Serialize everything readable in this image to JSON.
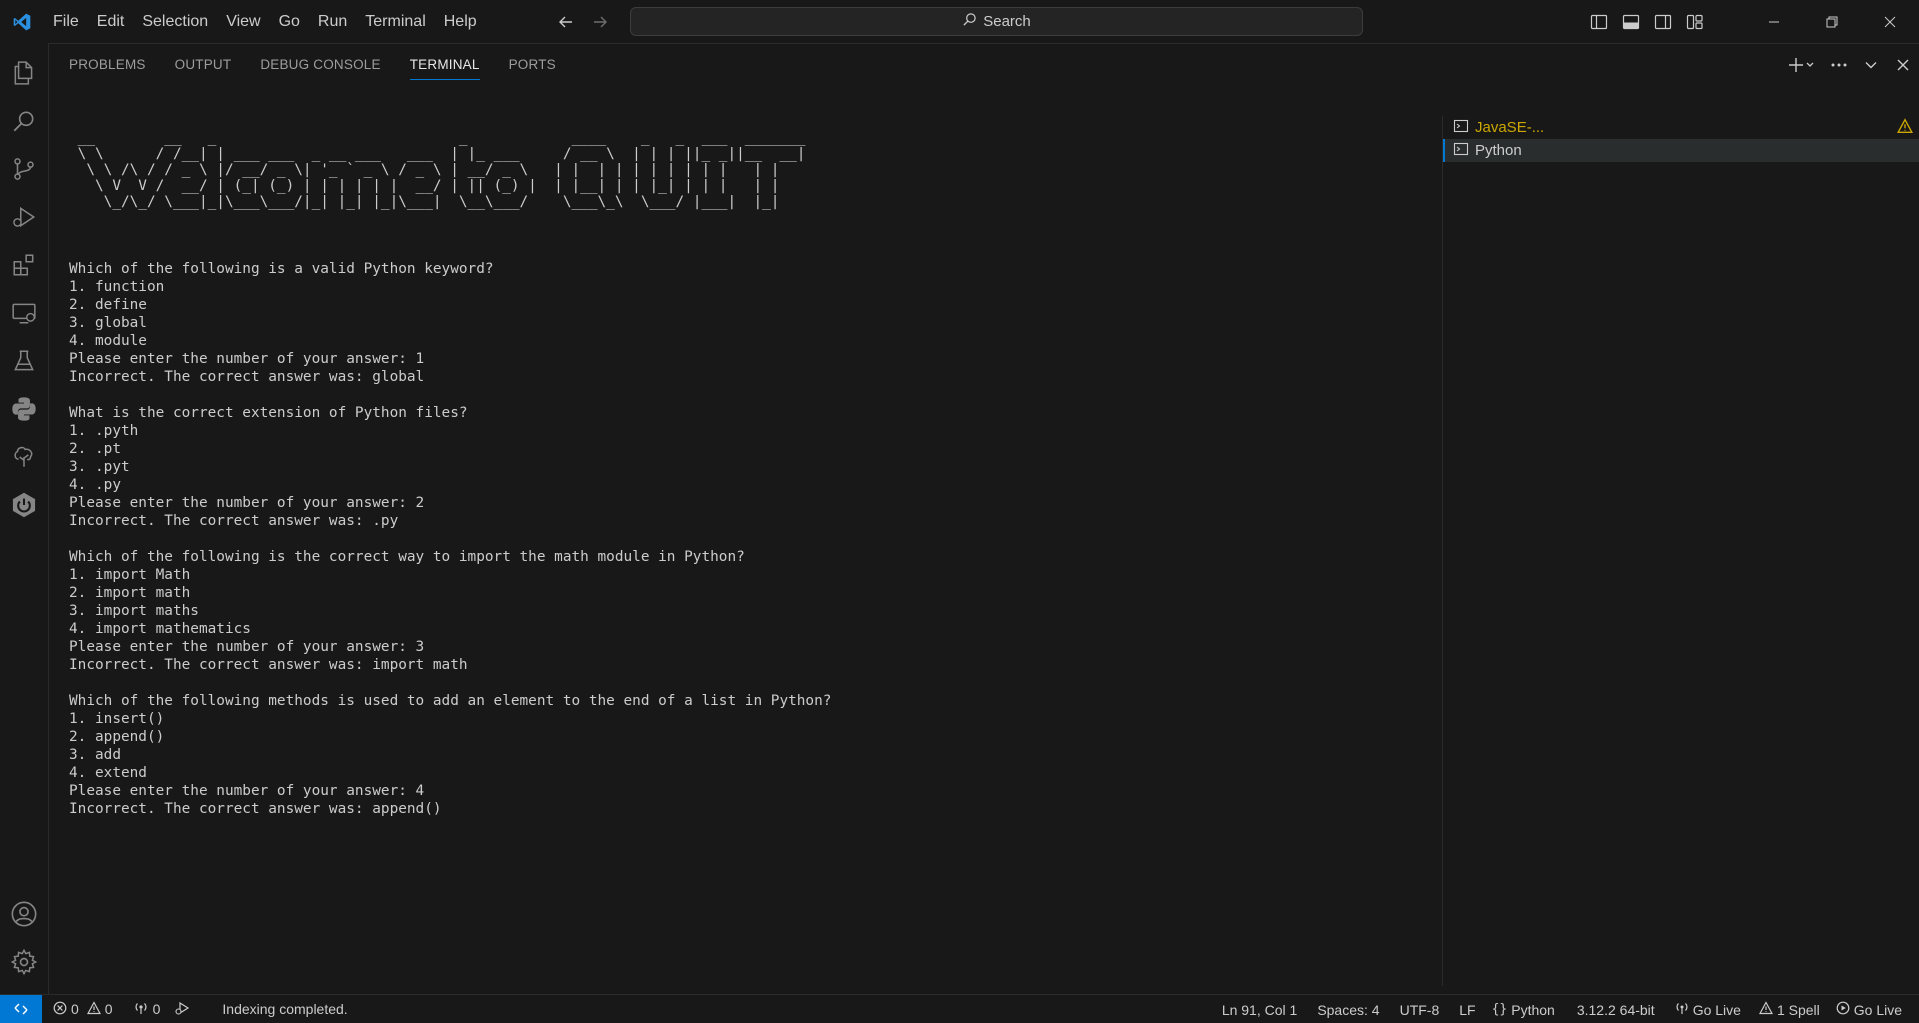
{
  "titlebar": {
    "menu": [
      "File",
      "Edit",
      "Selection",
      "View",
      "Go",
      "Run",
      "Terminal",
      "Help"
    ],
    "search_placeholder": "Search"
  },
  "colors": {
    "accent": "#0078d4",
    "background": "#181818",
    "text": "#cccccc",
    "warning": "#cca700"
  },
  "activity_bar": {
    "icons": [
      "files-icon",
      "search-icon",
      "source-control-icon",
      "run-debug-icon",
      "extensions-icon",
      "remote-explorer-icon",
      "testing-icon",
      "python-icon",
      "tree-icon",
      "power-icon",
      "account-icon",
      "settings-gear-icon"
    ]
  },
  "panel": {
    "tabs": [
      "PROBLEMS",
      "OUTPUT",
      "DEBUG CONSOLE",
      "TERMINAL",
      "PORTS"
    ],
    "active_tab": "TERMINAL"
  },
  "terminal": {
    "banner": [
      " __        __   _                            _            ____    _   _  ___  _______",
      " \\ \\      / /__| | ___ ___  _ __ ___   ___  | |_ ___     / __ \\  | | | ||_ _||__  __|",
      "  \\ \\ /\\ / / _ \\ |/ __/ _ \\| '_ ` _ \\ / _ \\ | __/ _ \\   | |  | | | | | | | |   | |",
      "   \\ V  V /  __/ | (_| (_) | | | | | |  __/ | || (_) |  | |__| | | |_| | | |   | |",
      "    \\_/\\_/ \\___|_|\\___\\___/|_| |_| |_|\\___|  \\__\\___/    \\___\\_\\  \\___/ |___|  |_|"
    ],
    "lines": [
      "Which of the following is a valid Python keyword?",
      "1. function",
      "2. define",
      "3. global",
      "4. module",
      "Please enter the number of your answer: 1",
      "Incorrect. The correct answer was: global",
      "",
      "What is the correct extension of Python files?",
      "1. .pyth",
      "2. .pt",
      "3. .pyt",
      "4. .py",
      "Please enter the number of your answer: 2",
      "Incorrect. The correct answer was: .py",
      "",
      "Which of the following is the correct way to import the math module in Python?",
      "1. import Math",
      "2. import math",
      "3. import maths",
      "4. import mathematics",
      "Please enter the number of your answer: 3",
      "Incorrect. The correct answer was: import math",
      "",
      "Which of the following methods is used to add an element to the end of a list in Python?",
      "1. insert()",
      "2. append()",
      "3. add",
      "4. extend",
      "Please enter the number of your answer: 4",
      "Incorrect. The correct answer was: append()"
    ],
    "instances": [
      {
        "name": "JavaSE-...",
        "warning": true
      },
      {
        "name": "Python",
        "warning": false,
        "active": true
      }
    ]
  },
  "statusbar": {
    "errors": "0",
    "warnings": "0",
    "ports": "0",
    "message": "Indexing completed.",
    "position": "Ln 91, Col 1",
    "spaces": "Spaces: 4",
    "encoding": "UTF-8",
    "eol": "LF",
    "language": "Python",
    "interpreter": "3.12.2 64-bit",
    "go_live_1": "Go Live",
    "spell": "1 Spell",
    "go_live_2": "Go Live"
  }
}
